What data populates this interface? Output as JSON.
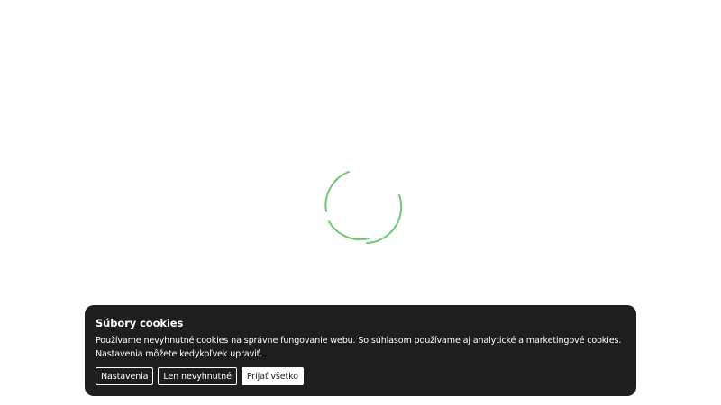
{
  "loader": {
    "icon": "spinner-icon",
    "color": "#6cc970"
  },
  "cookie_banner": {
    "title": "Súbory cookies",
    "text_line_1": "Používame nevyhnutné cookies na správne fungovanie webu. So súhlasom používame aj analytické a marketingové cookies.",
    "text_line_2": "Nastavenia môžete kedykoľvek upraviť.",
    "buttons": {
      "settings": "Nastavenia",
      "necessary_only": "Len nevyhnutné",
      "accept_all": "Prijať všetko"
    },
    "background": "#1e1e1e"
  }
}
